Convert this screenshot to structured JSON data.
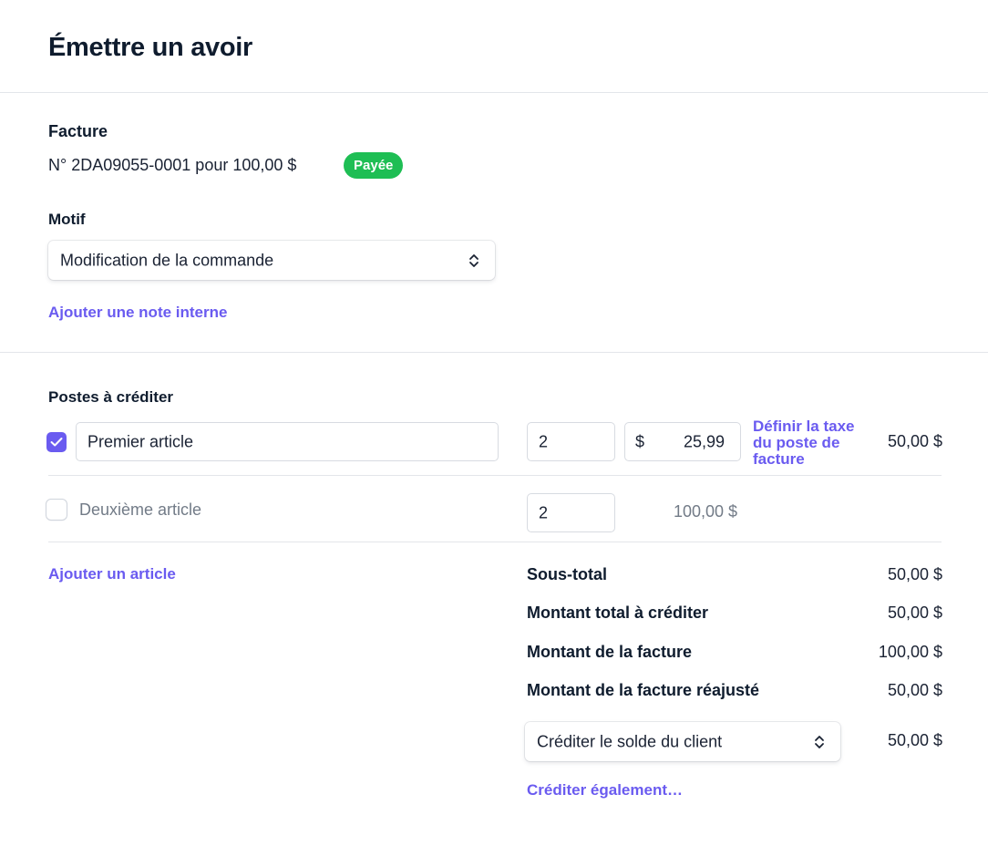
{
  "page": {
    "title": "Émettre un avoir"
  },
  "invoice": {
    "section_label": "Facture",
    "description": "N° 2DA09055-0001 pour 100,00 $",
    "status_badge": "Payée"
  },
  "reason": {
    "label": "Motif",
    "selected_value": "Modification de la commande",
    "add_note_link": "Ajouter une note interne"
  },
  "line_items": {
    "section_label": "Postes à créditer",
    "items": [
      {
        "checked": true,
        "name": "Premier article",
        "quantity": "2",
        "currency_symbol": "$",
        "unit_price": "25,99",
        "tax_link": "Définir la taxe du poste de facture",
        "amount": "50,00 $"
      },
      {
        "checked": false,
        "name": "Deuxième article",
        "quantity": "2",
        "amount": "100,00 $"
      }
    ],
    "add_item_link": "Ajouter un article"
  },
  "summary": {
    "subtotal_label": "Sous-total",
    "subtotal_value": "50,00 $",
    "total_credit_label": "Montant total à créditer",
    "total_credit_value": "50,00 $",
    "invoice_amount_label": "Montant de la facture",
    "invoice_amount_value": "100,00 $",
    "adjusted_amount_label": "Montant de la facture réajusté",
    "adjusted_amount_value": "50,00 $",
    "credit_method_selected": "Créditer le solde du client",
    "credit_method_value": "50,00 $",
    "credit_also_link": "Créditer également…"
  },
  "colors": {
    "accent": "#6a5bf0",
    "badge_green": "#1ebe54",
    "title": "#0f1c2e",
    "muted": "#727b87",
    "divider": "#e3e6ea"
  },
  "icons": {
    "select_chevron": "chevron-up-down-icon",
    "checkbox_check": "check-icon"
  }
}
